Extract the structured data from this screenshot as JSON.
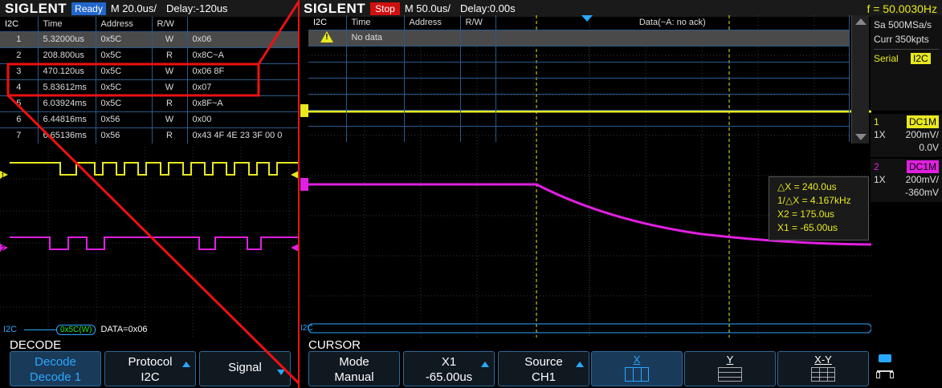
{
  "left": {
    "logo": "SIGLENT",
    "status": "Ready",
    "timebase": "M 20.0us/",
    "delay": "Delay:-120us",
    "table": {
      "headers": [
        "I2C",
        "Time",
        "Address",
        "R/W",
        ""
      ],
      "rows": [
        {
          "n": "1",
          "time": "5.32000us",
          "addr": "0x5C",
          "rw": "W",
          "data": "0x06"
        },
        {
          "n": "2",
          "time": "208.800us",
          "addr": "0x5C",
          "rw": "R",
          "data": "0x8C~A"
        },
        {
          "n": "3",
          "time": "470.120us",
          "addr": "0x5C",
          "rw": "W",
          "data": "0x06 8F"
        },
        {
          "n": "4",
          "time": "5.83612ms",
          "addr": "0x5C",
          "rw": "W",
          "data": "0x07"
        },
        {
          "n": "5",
          "time": "6.03924ms",
          "addr": "0x5C",
          "rw": "R",
          "data": "0x8F~A"
        },
        {
          "n": "6",
          "time": "6.44816ms",
          "addr": "0x56",
          "rw": "W",
          "data": "0x00"
        },
        {
          "n": "7",
          "time": "6.65136ms",
          "addr": "0x56",
          "rw": "R",
          "data": "0x43 4F 4E 23 3F 00 0"
        }
      ]
    },
    "bus_label": "I2C",
    "bus_decode": "0x5C(W)",
    "bus_data": "DATA=0x06",
    "ch1_marker": "1",
    "ch2_marker": "2",
    "panel_title": "DECODE",
    "buttons": [
      {
        "line1": "Decode",
        "line2": "Decode 1"
      },
      {
        "line1": "Protocol",
        "line2": "I2C"
      },
      {
        "line1": "Signal",
        "line2": ""
      }
    ]
  },
  "right": {
    "logo": "SIGLENT",
    "status": "Stop",
    "timebase": "M 50.0us/",
    "delay": "Delay:0.00s",
    "freq": "f = 50.0030Hz",
    "sample_rate": "Sa 500MSa/s",
    "curr_pts": "Curr 350kpts",
    "serial_label": "Serial",
    "serial_badge": "I2C",
    "ch1": {
      "num": "1",
      "coupling": "DC1M",
      "probe": "1X",
      "scale": "200mV/",
      "offset": "0.0V"
    },
    "ch2": {
      "num": "2",
      "coupling": "DC1M",
      "probe": "1X",
      "scale": "200mV/",
      "offset": "-360mV"
    },
    "table": {
      "headers": [
        "I2C",
        "Time",
        "Address",
        "R/W",
        "Data(~A: no ack)"
      ],
      "no_data": "No data",
      "warn": "!"
    },
    "cursor": {
      "dx": "△X = 240.0us",
      "inv_dx": "1/△X = 4.167kHz",
      "x2": "X2 = 175.0us",
      "x1": "X1 = -65.00us"
    },
    "bus_label": "I2C",
    "panel_title": "CURSOR",
    "buttons": [
      {
        "line1": "Mode",
        "line2": "Manual"
      },
      {
        "line1": "X1",
        "line2": "-65.00us"
      },
      {
        "line1": "Source",
        "line2": "CH1"
      },
      {
        "line1": "X",
        "line2": ""
      },
      {
        "line1": "Y",
        "line2": ""
      },
      {
        "line1": "X-Y",
        "line2": ""
      }
    ]
  },
  "colors": {
    "ch1": "#e8e820",
    "ch2": "#e020e0",
    "grid": "#3a3a3a",
    "accent": "#2aa8ff",
    "highlight": "#ee1111"
  }
}
